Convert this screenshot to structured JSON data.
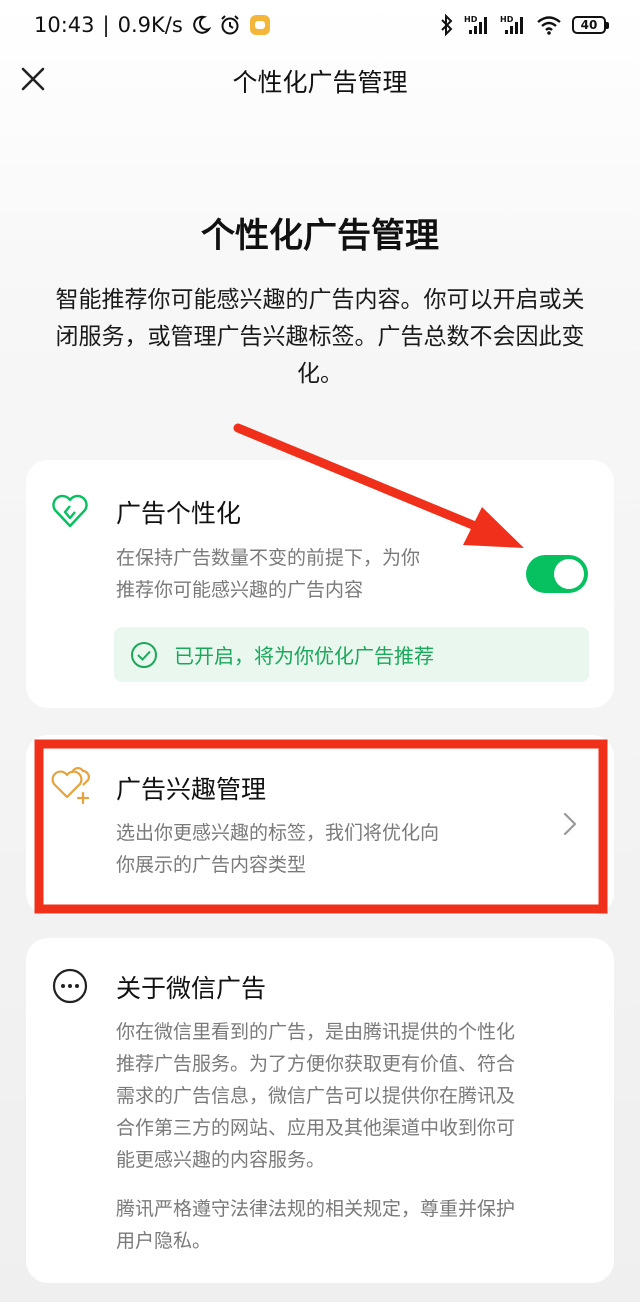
{
  "status_bar": {
    "time": "10:43",
    "network_speed": "0.9K/s",
    "signal_1_label": "HD",
    "signal_2_label": "HD",
    "battery": "40",
    "icons": [
      "moon-icon",
      "alarm-icon",
      "app-notification-icon",
      "bluetooth-icon",
      "signal-icon",
      "wifi-icon",
      "battery-icon"
    ]
  },
  "nav": {
    "title": "个性化广告管理",
    "close_icon": "close-icon"
  },
  "hero": {
    "title": "个性化广告管理",
    "description": "智能推荐你可能感兴趣的广告内容。你可以开启或关闭服务，或管理广告兴趣标签。广告总数不会因此变化。"
  },
  "personalization_card": {
    "icon": "heart-shield-icon",
    "title": "广告个性化",
    "description_line1": "在保持广告数量不变的前提下，为你",
    "description_line2": "推荐你可能感兴趣的广告内容",
    "toggle_on": true,
    "status_text": "已开启，将为你优化广告推荐",
    "status_icon": "check-circle-icon"
  },
  "interest_card": {
    "icon": "hearts-plus-icon",
    "title": "广告兴趣管理",
    "description_line1": "选出你更感兴趣的标签，我们将优化向",
    "description_line2": "你展示的广告内容类型",
    "chevron_icon": "chevron-right-icon"
  },
  "about_card": {
    "icon": "more-circle-icon",
    "title": "关于微信广告",
    "paragraph1_lines": [
      "你在微信里看到的广告，是由腾讯提供的个性化",
      "推荐广告服务。为了方便你获取更有价值、符合",
      "需求的广告信息，微信广告可以提供你在腾讯及",
      "合作第三方的网站、应用及其他渠道中收到你可",
      "能更感兴趣的内容服务。"
    ],
    "paragraph2_lines": [
      "腾讯严格遵守法律法规的相关规定，尊重并保护",
      "用户隐私。"
    ]
  },
  "colors": {
    "accent_green": "#07c160",
    "status_green_text": "#1aa85a",
    "status_green_bg": "#eaf7ef",
    "interest_icon_orange": "#e8a23c",
    "annotation_red": "#f0301a"
  }
}
